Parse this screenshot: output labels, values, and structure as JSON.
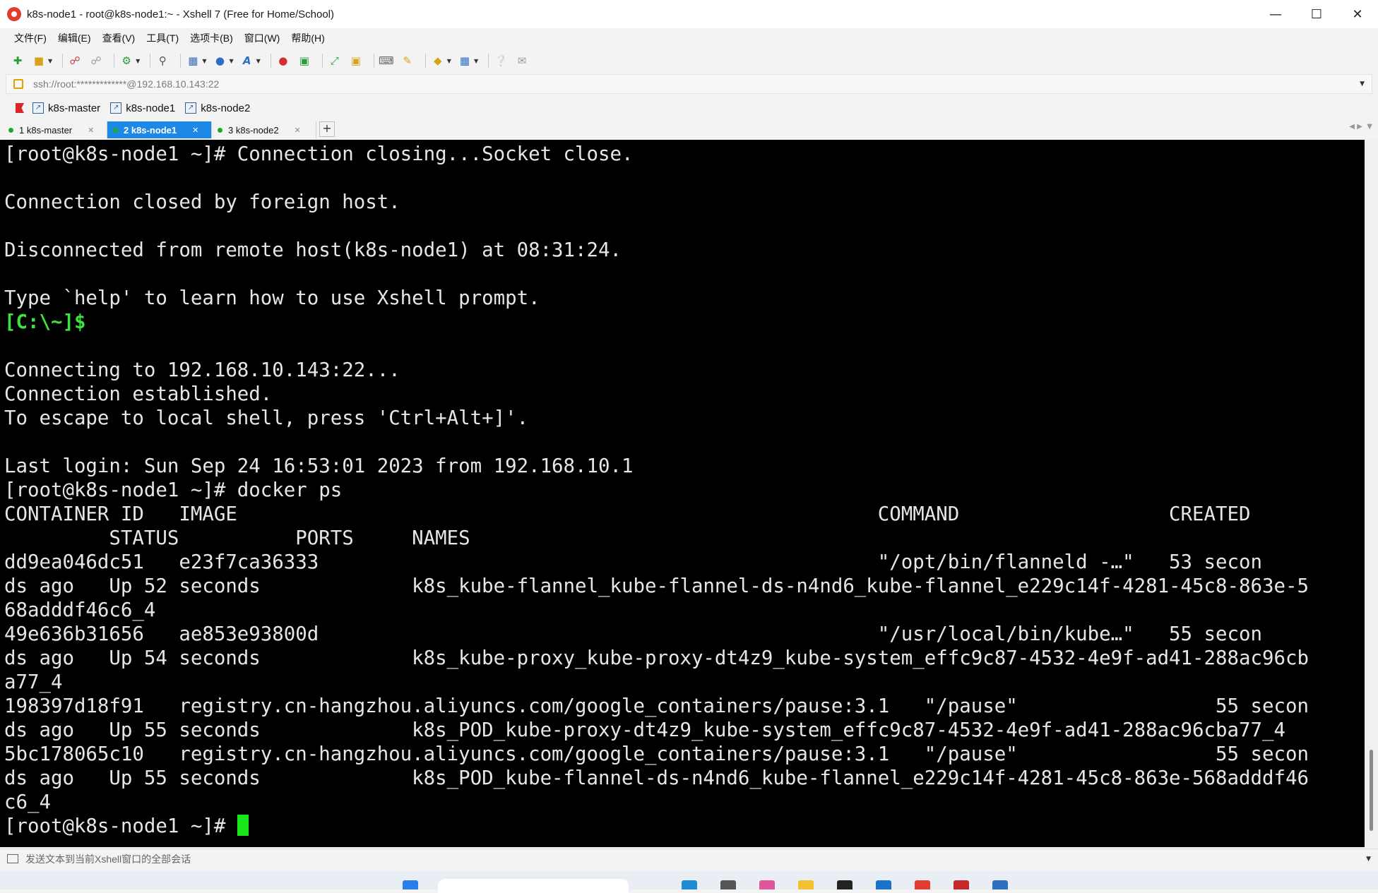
{
  "window": {
    "title": "k8s-node1 - root@k8s-node1:~ - Xshell 7 (Free for Home/School)"
  },
  "menu": [
    "文件(F)",
    "编辑(E)",
    "查看(V)",
    "工具(T)",
    "选项卡(B)",
    "窗口(W)",
    "帮助(H)"
  ],
  "address": "ssh://root:*************@192.168.10.143:22",
  "quick_sessions": [
    "k8s-master",
    "k8s-node1",
    "k8s-node2"
  ],
  "tabs": [
    {
      "label": "1 k8s-master",
      "active": false
    },
    {
      "label": "2 k8s-node1",
      "active": true
    },
    {
      "label": "3 k8s-node2",
      "active": false
    }
  ],
  "terminal": {
    "lines": [
      "[root@k8s-node1 ~]# Connection closing...Socket close.",
      "",
      "Connection closed by foreign host.",
      "",
      "Disconnected from remote host(k8s-node1) at 08:31:24.",
      "",
      "Type `help' to learn how to use Xshell prompt.",
      "[C:\\~]$",
      "",
      "Connecting to 192.168.10.143:22...",
      "Connection established.",
      "To escape to local shell, press 'Ctrl+Alt+]'.",
      "",
      "Last login: Sun Sep 24 16:53:01 2023 from 192.168.10.1",
      "[root@k8s-node1 ~]# docker ps",
      "CONTAINER ID   IMAGE                                                       COMMAND                  CREATED",
      "         STATUS          PORTS     NAMES",
      "dd9ea046dc51   e23f7ca36333                                                \"/opt/bin/flanneld -…\"   53 secon",
      "ds ago   Up 52 seconds             k8s_kube-flannel_kube-flannel-ds-n4nd6_kube-flannel_e229c14f-4281-45c8-863e-5",
      "68adddf46c6_4",
      "49e636b31656   ae853e93800d                                                \"/usr/local/bin/kube…\"   55 secon",
      "ds ago   Up 54 seconds             k8s_kube-proxy_kube-proxy-dt4z9_kube-system_effc9c87-4532-4e9f-ad41-288ac96cb",
      "a77_4",
      "198397d18f91   registry.cn-hangzhou.aliyuncs.com/google_containers/pause:3.1   \"/pause\"                 55 secon",
      "ds ago   Up 55 seconds             k8s_POD_kube-proxy-dt4z9_kube-system_effc9c87-4532-4e9f-ad41-288ac96cba77_4",
      "5bc178065c10   registry.cn-hangzhou.aliyuncs.com/google_containers/pause:3.1   \"/pause\"                 55 secon",
      "ds ago   Up 55 seconds             k8s_POD_kube-flannel-ds-n4nd6_kube-flannel_e229c14f-4281-45c8-863e-568adddf46",
      "c6_4"
    ],
    "prompt": "[root@k8s-node1 ~]# "
  },
  "status": {
    "send_text": "发送文本到当前Xshell窗口的全部会话"
  },
  "colors": {
    "active_tab": "#1e88e5",
    "terminal_bg": "#000000",
    "terminal_fg": "#e6e6e6",
    "local_prompt": "#3ee23e",
    "cursor": "#19e619"
  }
}
